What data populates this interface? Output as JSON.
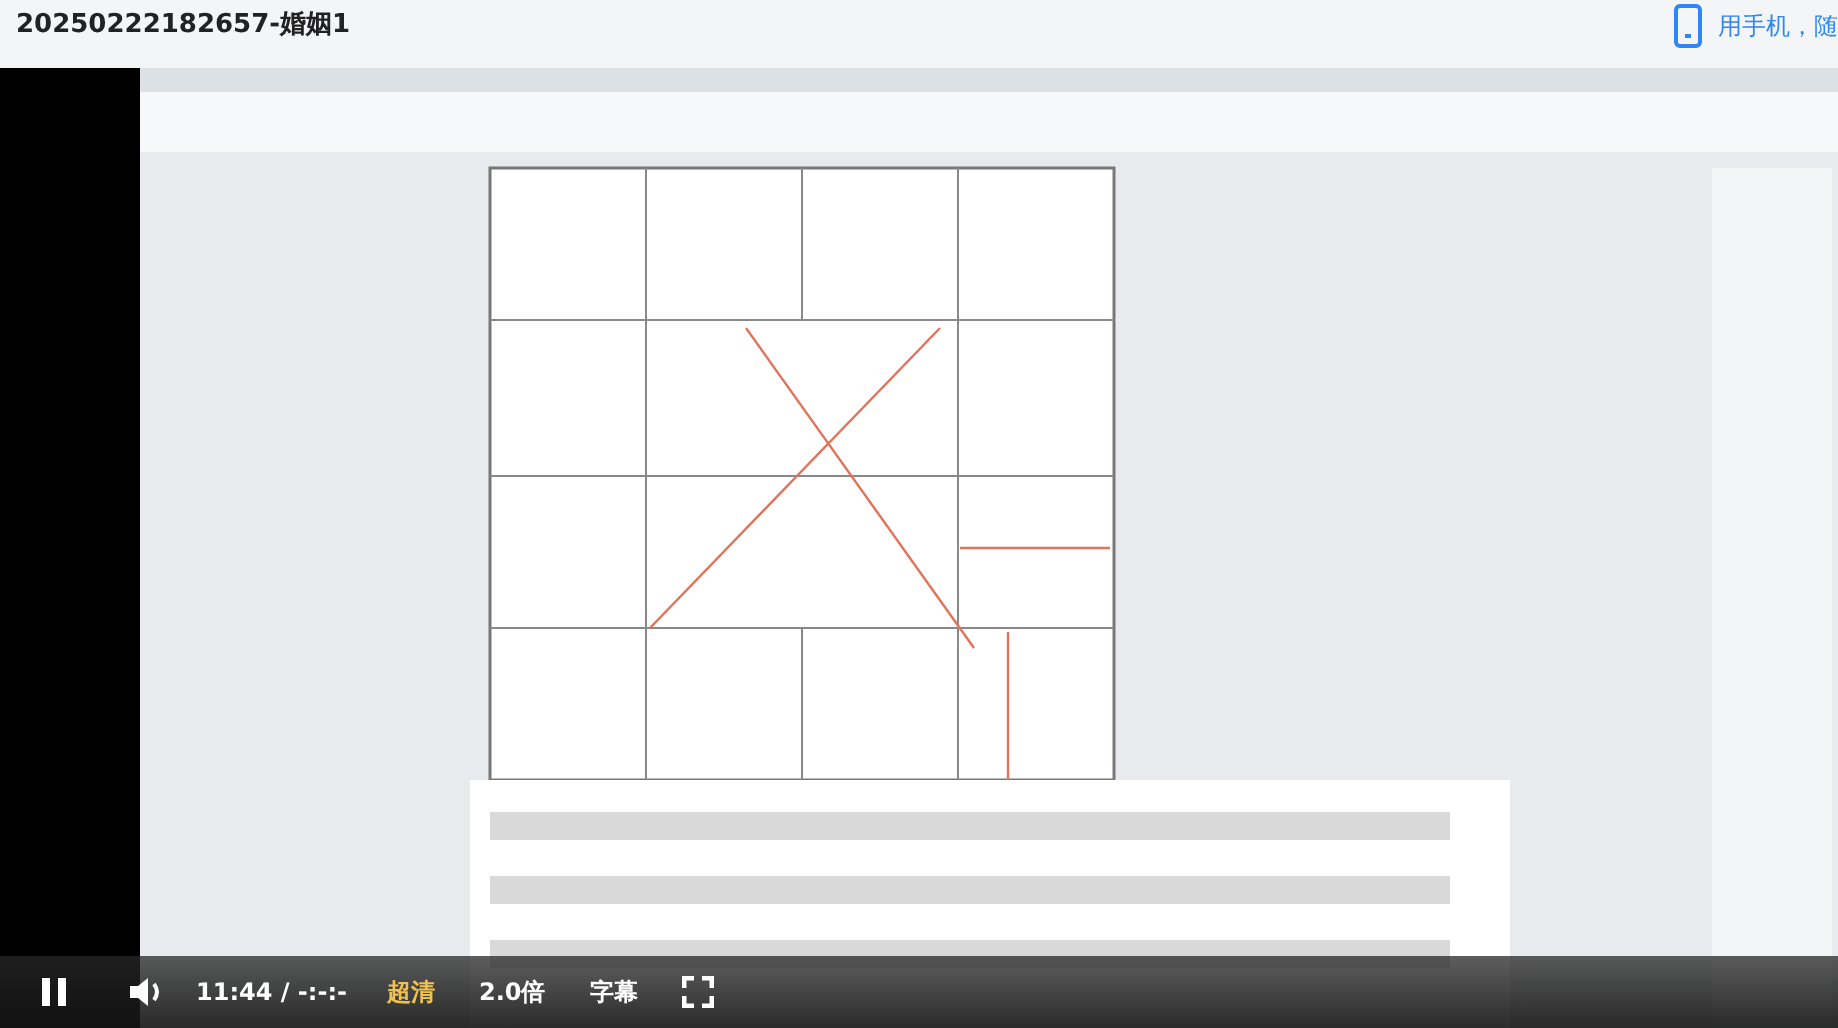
{
  "page_title": "20250222182657-婚姻1",
  "mobile_link": {
    "label": "用手机，随"
  },
  "player": {
    "playing": true,
    "time": "11:44 / -:-:-",
    "quality": "超清",
    "speed": "2.0倍",
    "subtitles": "字幕"
  }
}
